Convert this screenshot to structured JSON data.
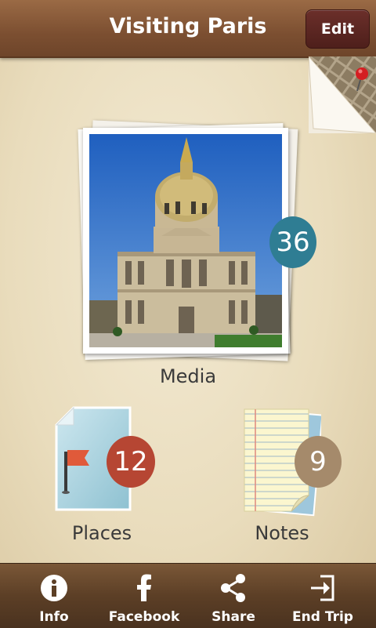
{
  "header": {
    "title": "Visiting Paris",
    "edit_label": "Edit"
  },
  "media": {
    "label": "Media",
    "count": "36"
  },
  "places": {
    "label": "Places",
    "count": "12"
  },
  "notes": {
    "label": "Notes",
    "count": "9"
  },
  "tabs": [
    {
      "label": "Info",
      "icon": "info-icon"
    },
    {
      "label": "Facebook",
      "icon": "facebook-icon"
    },
    {
      "label": "Share",
      "icon": "share-icon"
    },
    {
      "label": "End Trip",
      "icon": "exit-icon"
    }
  ],
  "colors": {
    "header": "#7c4f31",
    "edit": "#5a2520",
    "media_badge": "#2f7d93",
    "places_badge": "#b64633",
    "notes_badge": "#a58a6b"
  }
}
